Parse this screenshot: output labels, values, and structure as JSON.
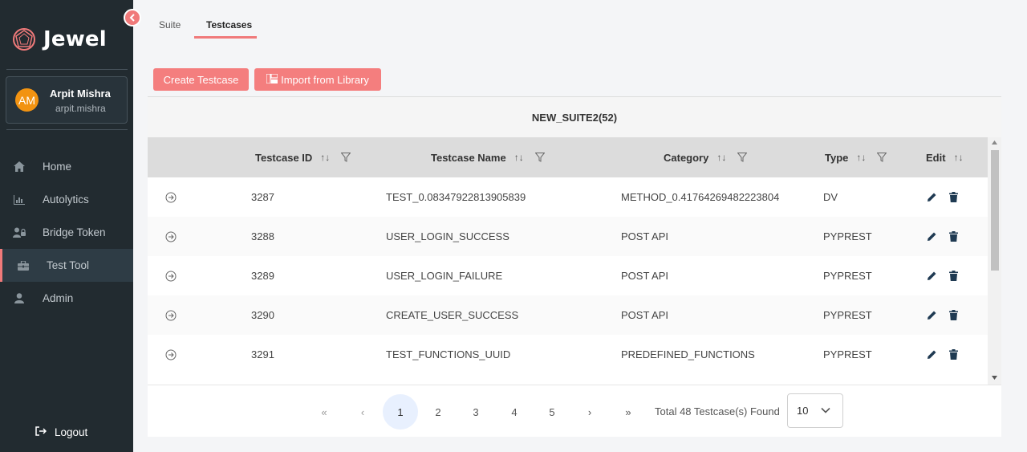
{
  "app": {
    "name": "Jewel"
  },
  "user": {
    "initials": "AM",
    "name": "Arpit Mishra",
    "username": "arpit.mishra"
  },
  "sidebar": {
    "items": [
      {
        "label": "Home",
        "icon": "home-icon",
        "active": false
      },
      {
        "label": "Autolytics",
        "icon": "chart-icon",
        "active": false
      },
      {
        "label": "Bridge Token",
        "icon": "users-icon",
        "active": false
      },
      {
        "label": "Test Tool",
        "icon": "toolbox-icon",
        "active": true
      },
      {
        "label": "Admin",
        "icon": "user-icon",
        "active": false
      }
    ],
    "logout_label": "Logout"
  },
  "tabs": [
    {
      "label": "Suite",
      "active": false
    },
    {
      "label": "Testcases",
      "active": true
    }
  ],
  "actions": {
    "create_label": "Create Testcase",
    "import_label": "Import from Library"
  },
  "suite": {
    "title": "NEW_SUITE2(52)"
  },
  "table": {
    "columns": [
      "Testcase ID",
      "Testcase Name",
      "Category",
      "Type",
      "Edit"
    ],
    "sort_glyph": "↑↓",
    "rows": [
      {
        "id": "3287",
        "name": "TEST_0.08347922813905839",
        "category": "METHOD_0.41764269482223804",
        "type": "DV"
      },
      {
        "id": "3288",
        "name": "USER_LOGIN_SUCCESS",
        "category": "POST API",
        "type": "PYPREST"
      },
      {
        "id": "3289",
        "name": "USER_LOGIN_FAILURE",
        "category": "POST API",
        "type": "PYPREST"
      },
      {
        "id": "3290",
        "name": "CREATE_USER_SUCCESS",
        "category": "POST API",
        "type": "PYPREST"
      },
      {
        "id": "3291",
        "name": "TEST_FUNCTIONS_UUID",
        "category": "PREDEFINED_FUNCTIONS",
        "type": "PYPREST"
      }
    ]
  },
  "pagination": {
    "first": "«",
    "prev": "‹",
    "pages": [
      "1",
      "2",
      "3",
      "4",
      "5"
    ],
    "current": "1",
    "next": "›",
    "last": "»",
    "total_text": "Total 48 Testcase(s) Found",
    "rows_per_page": "10"
  },
  "colors": {
    "accent": "#f47e7e",
    "sidebar_bg": "#222b30",
    "edit_icon": "#1f3a52"
  }
}
